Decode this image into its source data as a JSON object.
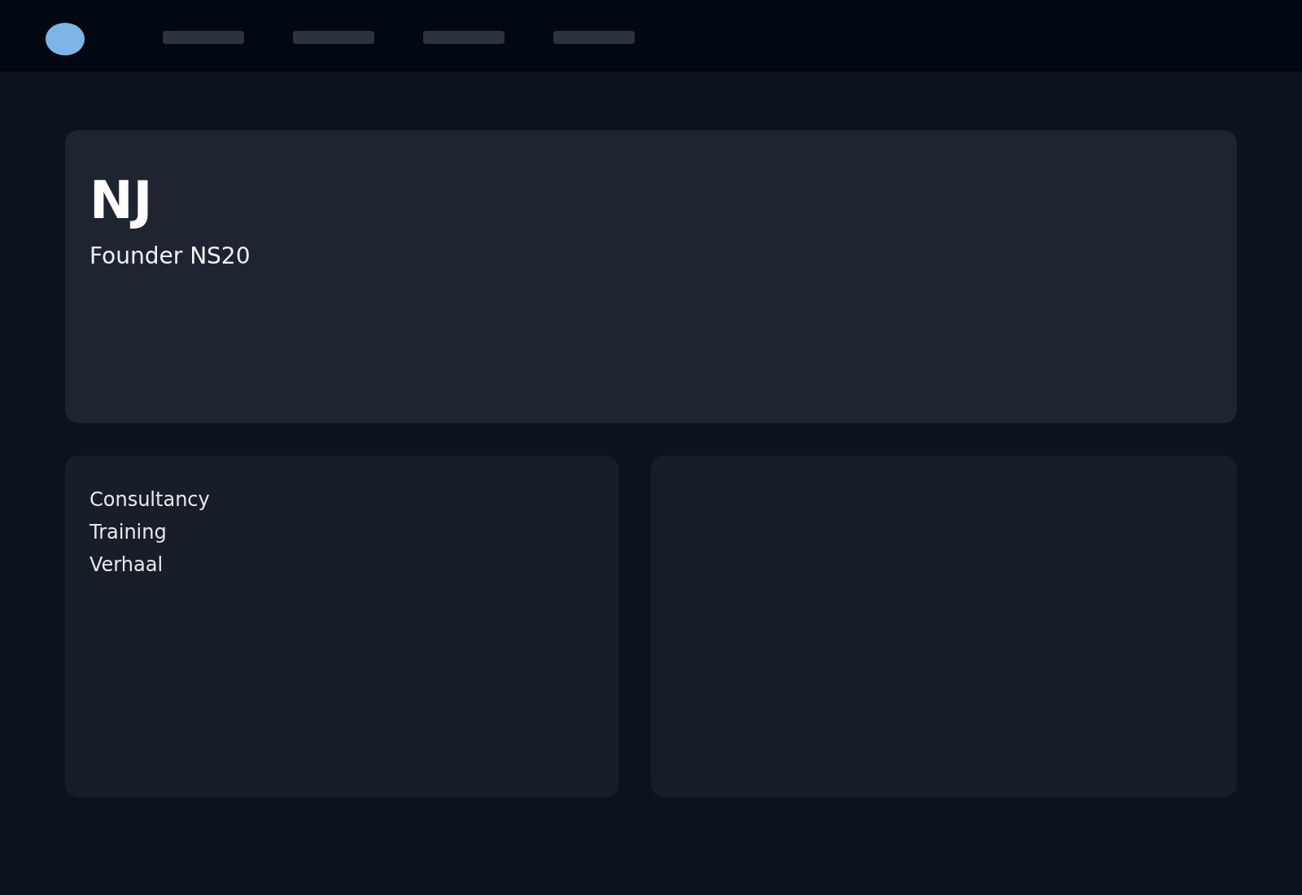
{
  "header": {
    "nav_items": [
      {
        "kind": "skeleton"
      },
      {
        "kind": "skeleton"
      },
      {
        "kind": "skeleton"
      },
      {
        "kind": "skeleton"
      }
    ]
  },
  "hero": {
    "title": "NJ",
    "subtitle": "Founder NS20"
  },
  "services": {
    "items": [
      "Consultancy",
      "Training",
      "Verhaal"
    ]
  }
}
